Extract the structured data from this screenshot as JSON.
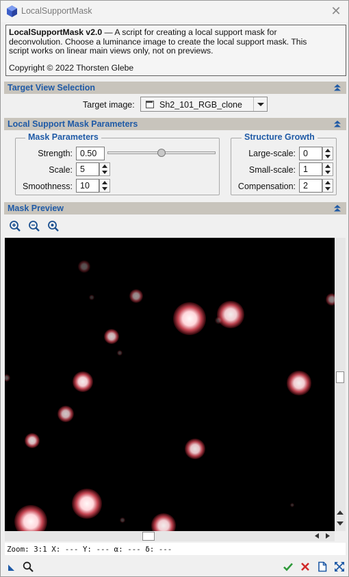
{
  "window": {
    "title": "LocalSupportMask",
    "close_glyph": "✕"
  },
  "info": {
    "script_name": "LocalSupportMask v2.0",
    "line1_rest": " — A script for creating a local support mask for",
    "line2": "deconvolution. Choose a luminance image to create the local support mask. This",
    "line3": "script works on linear main views only, not on previews.",
    "copyright": "Copyright © 2022 Thorsten Glebe"
  },
  "sections": {
    "target_view": "Target View Selection",
    "mask_params": "Local Support Mask Parameters",
    "mask_preview": "Mask Preview"
  },
  "target": {
    "label": "Target image:",
    "selected": "Sh2_101_RGB_clone"
  },
  "mask_parameters": {
    "title": "Mask Parameters",
    "strength_label": "Strength:",
    "strength_value": "0.50",
    "scale_label": "Scale:",
    "scale_value": "5",
    "smoothness_label": "Smoothness:",
    "smoothness_value": "10"
  },
  "structure_growth": {
    "title": "Structure Growth",
    "large_label": "Large-scale:",
    "large_value": "0",
    "small_label": "Small-scale:",
    "small_value": "1",
    "comp_label": "Compensation:",
    "comp_value": "2"
  },
  "preview_tools": [
    "zoom-in-icon",
    "zoom-out-icon",
    "zoom-fit-icon"
  ],
  "status": {
    "text": "Zoom: 3:1 X: --- Y: --- α: --- δ: ---"
  },
  "bottom_icons": [
    "new-instance-icon",
    "preview-icon",
    "ok-icon",
    "cancel-icon",
    "reset-icon",
    "maximize-icon"
  ],
  "colors": {
    "accent": "#1f5aa6",
    "section_bar": "#c8c4bc",
    "ok_green": "#2e9a3a",
    "cancel_red": "#d12b2b"
  }
}
